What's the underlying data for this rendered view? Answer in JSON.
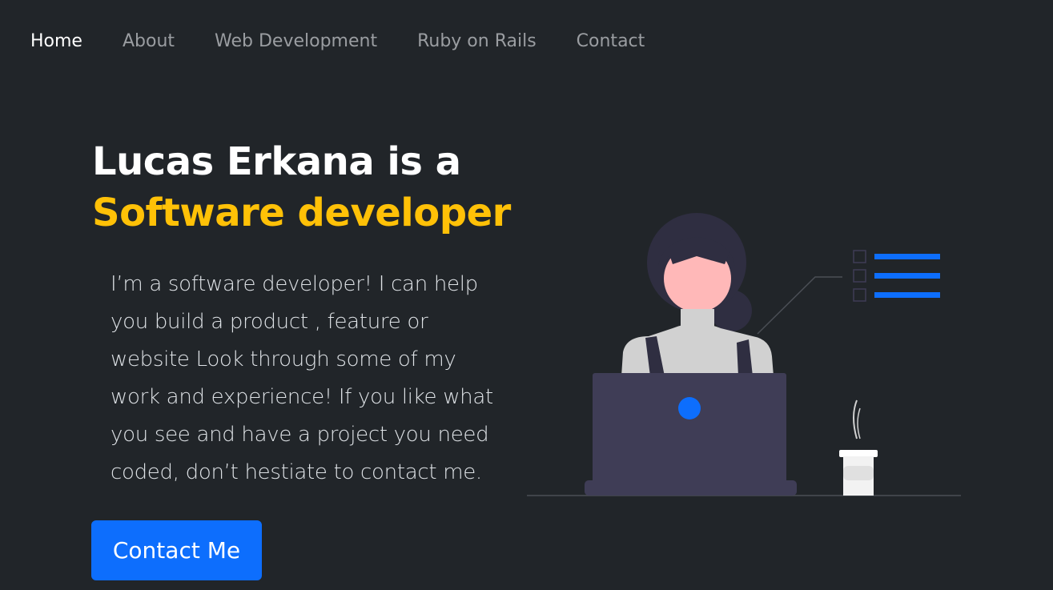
{
  "nav": {
    "items": [
      {
        "label": "Home",
        "active": true
      },
      {
        "label": "About",
        "active": false
      },
      {
        "label": "Web Development",
        "active": false
      },
      {
        "label": "Ruby on Rails",
        "active": false
      },
      {
        "label": "Contact",
        "active": false
      }
    ]
  },
  "hero": {
    "title_line1": "Lucas Erkana is a",
    "title_line2": "Software developer",
    "description": "I’m a software developer! I can help you build a product , feature or website Look through some of my work and experience! If you like what you see and have a project you need coded, don’t hestiate to contact me.",
    "cta_label": "Contact Me"
  },
  "illustration": {
    "name": "developer-at-laptop-illustration"
  },
  "colors": {
    "background": "#212529",
    "accent": "#ffc107",
    "primary": "#0d6efd",
    "nav_inactive": "#9a9da1",
    "text": "#ffffff"
  }
}
